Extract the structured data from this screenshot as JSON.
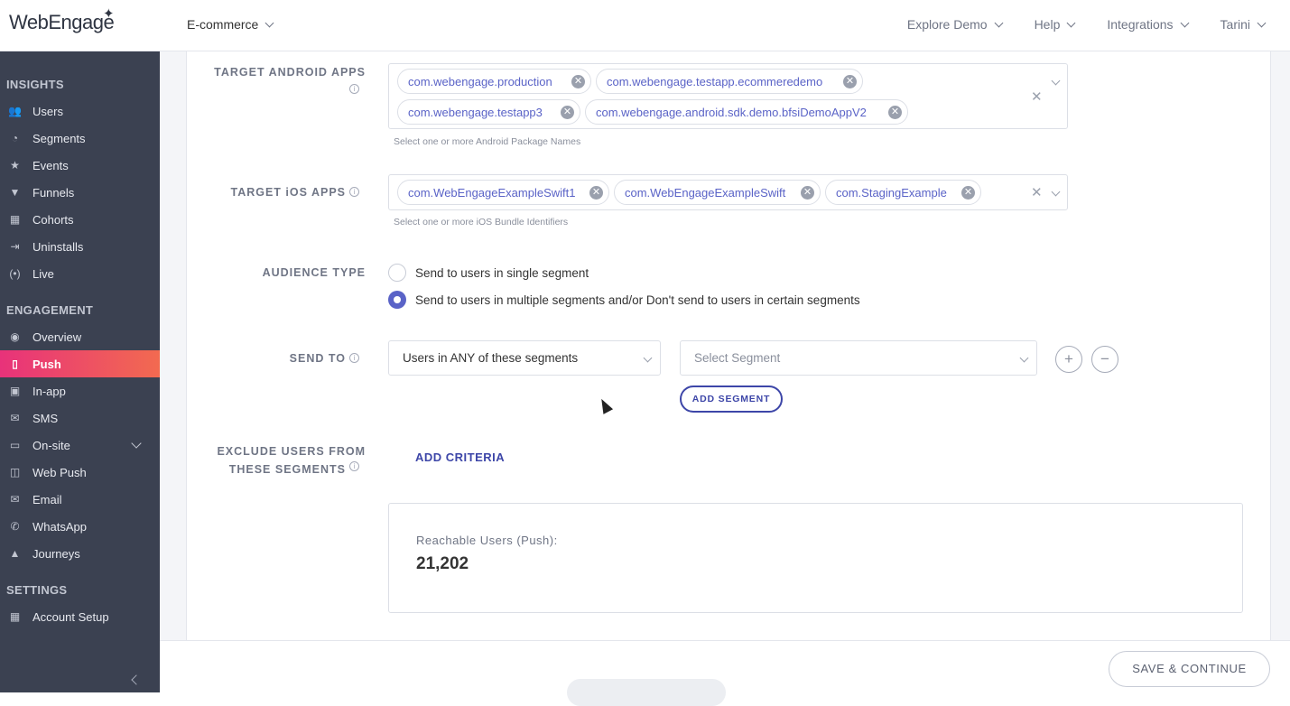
{
  "brand": {
    "logo_text": "WebEngage"
  },
  "header": {
    "project": "E-commerce",
    "nav": [
      "Explore Demo",
      "Help",
      "Integrations",
      "Tarini"
    ]
  },
  "sidebar": {
    "insights_title": "INSIGHTS",
    "insights": [
      {
        "label": "Users",
        "icon": "users-icon"
      },
      {
        "label": "Segments",
        "icon": "pie-icon"
      },
      {
        "label": "Events",
        "icon": "star-icon"
      },
      {
        "label": "Funnels",
        "icon": "funnel-icon"
      },
      {
        "label": "Cohorts",
        "icon": "grid-icon"
      },
      {
        "label": "Uninstalls",
        "icon": "exit-icon"
      },
      {
        "label": "Live",
        "icon": "broadcast-icon"
      }
    ],
    "engagement_title": "ENGAGEMENT",
    "engagement": [
      {
        "label": "Overview",
        "icon": "eye-icon"
      },
      {
        "label": "Push",
        "icon": "push-icon",
        "active": true
      },
      {
        "label": "In-app",
        "icon": "inapp-icon"
      },
      {
        "label": "SMS",
        "icon": "sms-icon"
      },
      {
        "label": "On-site",
        "icon": "onsite-icon"
      },
      {
        "label": "Web Push",
        "icon": "webpush-icon"
      },
      {
        "label": "Email",
        "icon": "email-icon"
      },
      {
        "label": "WhatsApp",
        "icon": "whatsapp-icon"
      },
      {
        "label": "Journeys",
        "icon": "rocket-icon"
      }
    ],
    "settings_title": "SETTINGS",
    "settings": [
      {
        "label": "Account Setup",
        "icon": "dashboard-icon"
      }
    ]
  },
  "form": {
    "android": {
      "label": "TARGET ANDROID APPS",
      "tags": [
        "com.webengage.production",
        "com.webengage.testapp.ecommeredemo",
        "com.webengage.testapp3",
        "com.webengage.android.sdk.demo.bfsiDemoAppV2"
      ],
      "help": "Select one or more Android Package Names"
    },
    "ios": {
      "label": "TARGET iOS APPS",
      "tags": [
        "com.WebEngageExampleSwift1",
        "com.WebEngageExampleSwift",
        "com.StagingExample"
      ],
      "help": "Select one or more iOS Bundle Identifiers"
    },
    "audience": {
      "label": "AUDIENCE TYPE",
      "options": [
        "Send to users in single segment",
        "Send to users in multiple segments and/or Don't send to users in certain segments"
      ],
      "selected": 1
    },
    "send_to": {
      "label": "SEND TO",
      "mode": "Users in ANY of these segments",
      "segment_placeholder": "Select Segment",
      "add_segment": "ADD SEGMENT"
    },
    "exclude": {
      "label_line1": "EXCLUDE USERS FROM",
      "label_line2": "THESE SEGMENTS",
      "add_criteria": "ADD CRITERIA"
    },
    "reach": {
      "label": "Reachable Users (Push):",
      "value": "21,202"
    }
  },
  "footer": {
    "save": "SAVE & CONTINUE"
  },
  "colors": {
    "accent": "#5a63c7",
    "primary_dark": "#3d46a8",
    "sidebar_bg": "#3b4151",
    "active_start": "#e8327a",
    "active_end": "#f26a50"
  }
}
